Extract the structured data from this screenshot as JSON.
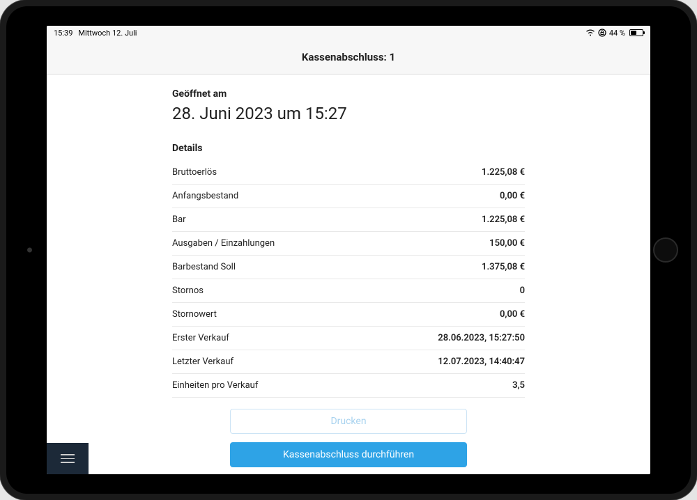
{
  "statusBar": {
    "time": "15:39",
    "date": "Mittwoch 12. Juli",
    "batteryText": "44 %"
  },
  "header": {
    "title": "Kassenabschluss: 1"
  },
  "opened": {
    "label": "Geöffnet am",
    "date": "28. Juni 2023 um 15:27"
  },
  "detailsLabel": "Details",
  "details": [
    {
      "label": "Bruttoerlös",
      "value": "1.225,08 €"
    },
    {
      "label": "Anfangsbestand",
      "value": "0,00 €"
    },
    {
      "label": "Bar",
      "value": "1.225,08 €"
    },
    {
      "label": "Ausgaben / Einzahlungen",
      "value": "150,00 €"
    },
    {
      "label": "Barbestand Soll",
      "value": "1.375,08 €"
    },
    {
      "label": "Stornos",
      "value": "0"
    },
    {
      "label": "Stornowert",
      "value": "0,00 €"
    },
    {
      "label": "Erster Verkauf",
      "value": "28.06.2023, 15:27:50"
    },
    {
      "label": "Letzter Verkauf",
      "value": "12.07.2023, 14:40:47"
    },
    {
      "label": "Einheiten pro Verkauf",
      "value": "3,5"
    }
  ],
  "buttons": {
    "print": "Drucken",
    "close": "Kassenabschluss durchführen"
  }
}
